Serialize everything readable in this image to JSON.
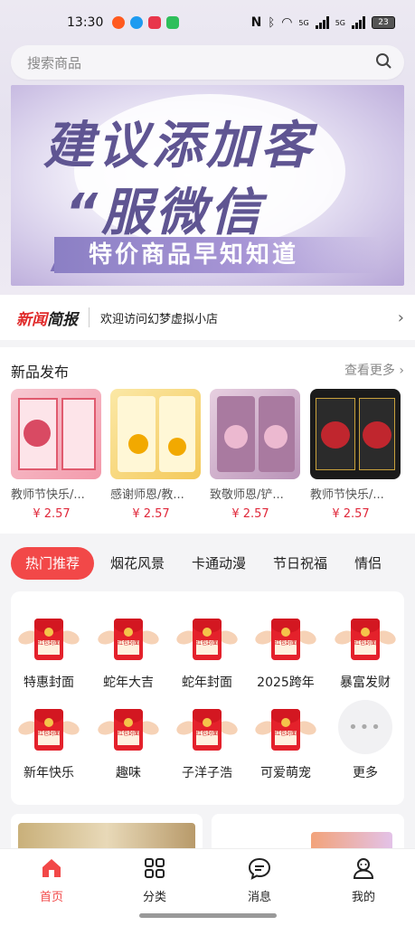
{
  "status": {
    "time": "13:30",
    "battery": "23",
    "network_5g_1": "5G",
    "network_5g_2": "5G"
  },
  "search": {
    "placeholder": "搜索商品"
  },
  "banner": {
    "line1": "建议添加客",
    "line2": "“服微信",
    "line3": "特价商品早知知道"
  },
  "news": {
    "title_part1": "新闻",
    "title_part2": "简报",
    "text": "欢迎访问幻梦虚拟小店"
  },
  "new_products": {
    "heading": "新品发布",
    "more": "查看更多",
    "items": [
      {
        "name": "教师节快乐/...",
        "price": "¥ 2.57"
      },
      {
        "name": "感谢师恩/教...",
        "price": "¥ 2.57"
      },
      {
        "name": "致敬师恩/铲...",
        "price": "¥ 2.57"
      },
      {
        "name": "教师节快乐/...",
        "price": "¥ 2.57"
      }
    ]
  },
  "tabs": [
    "热门推荐",
    "烟花风景",
    "卡通动漫",
    "节日祝福",
    "情侣"
  ],
  "categories": [
    {
      "label": "特惠封面"
    },
    {
      "label": "蛇年大吉"
    },
    {
      "label": "蛇年封面"
    },
    {
      "label": "2025跨年"
    },
    {
      "label": "暴富发财"
    },
    {
      "label": "新年快乐"
    },
    {
      "label": "趣味"
    },
    {
      "label": "子洋子浩"
    },
    {
      "label": "可爱萌宠"
    },
    {
      "label": "更多"
    }
  ],
  "envelope_text": "红包封面",
  "nav": [
    "首页",
    "分类",
    "消息",
    "我的"
  ],
  "colors": {
    "accent": "#f24848",
    "price": "#e0283a",
    "banner_text": "#5f5592"
  }
}
